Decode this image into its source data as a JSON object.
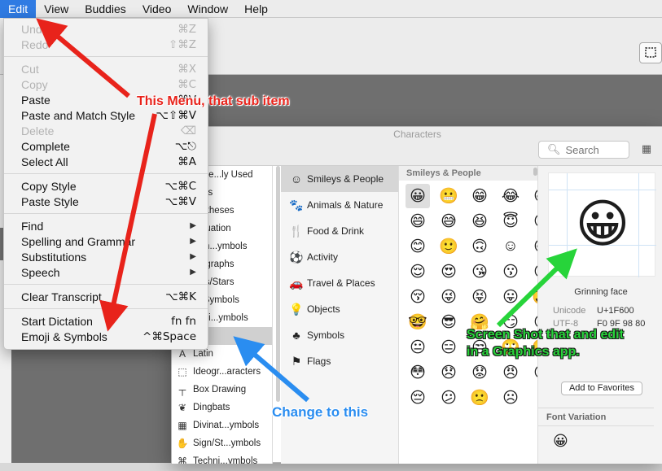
{
  "menubar": {
    "items": [
      "Edit",
      "View",
      "Buddies",
      "Video",
      "Window",
      "Help"
    ]
  },
  "edit_menu": {
    "items": [
      {
        "label": "Undo",
        "shortcut": "⌘Z",
        "enabled": false
      },
      {
        "label": "Redo",
        "shortcut": "⇧⌘Z",
        "enabled": false
      },
      {
        "label": "Cut",
        "shortcut": "⌘X",
        "enabled": false
      },
      {
        "label": "Copy",
        "shortcut": "⌘C",
        "enabled": false
      },
      {
        "label": "Paste",
        "shortcut": "⌘V",
        "enabled": true
      },
      {
        "label": "Paste and Match Style",
        "shortcut": "⌥⇧⌘V",
        "enabled": true
      },
      {
        "label": "Delete",
        "shortcut": "⌫",
        "enabled": false
      },
      {
        "label": "Complete",
        "shortcut": "⌥⎋",
        "enabled": true
      },
      {
        "label": "Select All",
        "shortcut": "⌘A",
        "enabled": true
      },
      {
        "label": "Copy Style",
        "shortcut": "⌥⌘C",
        "enabled": true
      },
      {
        "label": "Paste Style",
        "shortcut": "⌥⌘V",
        "enabled": true
      },
      {
        "label": "Find",
        "shortcut": "▶",
        "enabled": true
      },
      {
        "label": "Spelling and Grammar",
        "shortcut": "▶",
        "enabled": true
      },
      {
        "label": "Substitutions",
        "shortcut": "▶",
        "enabled": true
      },
      {
        "label": "Speech",
        "shortcut": "▶",
        "enabled": true
      },
      {
        "label": "Clear Transcript",
        "shortcut": "⌥⌘K",
        "enabled": true
      },
      {
        "label": "Start Dictation",
        "shortcut": "fn fn",
        "enabled": true
      },
      {
        "label": "Emoji & Symbols",
        "shortcut": "^⌘Space",
        "enabled": true
      }
    ]
  },
  "characters_window": {
    "title": "Characters",
    "search_placeholder": "Search",
    "list": [
      {
        "icon": "",
        "label": "eque...ly Used"
      },
      {
        "icon": "",
        "label": "rows"
      },
      {
        "icon": "",
        "label": "rentheses"
      },
      {
        "icon": "",
        "label": "nctuation"
      },
      {
        "icon": "",
        "label": "rren...ymbols"
      },
      {
        "icon": "",
        "label": "ctographs"
      },
      {
        "icon": "",
        "label": "llets/Stars"
      },
      {
        "icon": "",
        "label": "th Symbols"
      },
      {
        "icon": "",
        "label": "tterli...ymbols"
      },
      {
        "icon": "",
        "label": "oji"
      },
      {
        "icon": "A",
        "label": "Latin"
      },
      {
        "icon": "⬚",
        "label": "Ideogr...aracters"
      },
      {
        "icon": "┬",
        "label": "Box Drawing"
      },
      {
        "icon": "❦",
        "label": "Dingbats"
      },
      {
        "icon": "▦",
        "label": "Divinat...ymbols"
      },
      {
        "icon": "✋",
        "label": "Sign/St...ymbols"
      },
      {
        "icon": "⌘",
        "label": "Techni...ymbols"
      }
    ],
    "categories": [
      {
        "icon": "☺",
        "label": "Smileys & People"
      },
      {
        "icon": "🐾",
        "label": "Animals & Nature"
      },
      {
        "icon": "🍴",
        "label": "Food & Drink"
      },
      {
        "icon": "⚽",
        "label": "Activity"
      },
      {
        "icon": "🚗",
        "label": "Travel & Places"
      },
      {
        "icon": "💡",
        "label": "Objects"
      },
      {
        "icon": "♣",
        "label": "Symbols"
      },
      {
        "icon": "⚑",
        "label": "Flags"
      }
    ],
    "grid_header": "Smileys & People",
    "grid": [
      "😀",
      "😬",
      "😁",
      "😂",
      "😃",
      "😄",
      "😅",
      "😆",
      "😇",
      "😉",
      "😊",
      "🙂",
      "🙃",
      "☺",
      "😋",
      "😌",
      "😍",
      "😘",
      "😗",
      "😙",
      "😚",
      "😜",
      "😝",
      "😛",
      "🤑",
      "🤓",
      "😎",
      "🤗",
      "😏",
      "😶",
      "😐",
      "😑",
      "😒",
      "🙄",
      "🤔",
      "😳",
      "😞",
      "😟",
      "😠",
      "😡",
      "😔",
      "😕",
      "🙁",
      "☹"
    ],
    "detail": {
      "preview": "😀",
      "name": "Grinning face",
      "unicode_label": "Unicode",
      "unicode_value": "U+1F600",
      "utf8_label": "UTF-8",
      "utf8_value": "F0 9F 98 80",
      "fav_button": "Add to Favorites",
      "font_variation_header": "Font Variation",
      "font_variation_glyph": "😀"
    }
  },
  "annotations": {
    "menu_note": "This Menu, that sub item",
    "change_note": "Change to this",
    "shot_note_line1": "Screen Shot that and edit",
    "shot_note_line2": "in a Graphics app."
  },
  "colors": {
    "menu_highlight": "#2f7be3",
    "annotation_red": "#e8231b",
    "annotation_blue": "#2a8df0",
    "annotation_green": "#27d43a"
  }
}
